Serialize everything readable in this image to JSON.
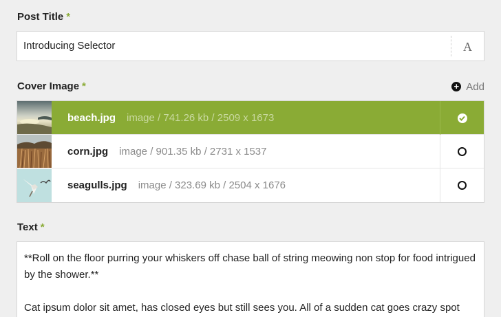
{
  "post_title": {
    "label": "Post Title",
    "required_mark": "*",
    "value": "Introducing Selector",
    "format_icon": "A"
  },
  "cover_image": {
    "label": "Cover Image",
    "required_mark": "*",
    "add_label": "Add",
    "add_icon": "plus-circle-icon",
    "images": [
      {
        "name": "beach.jpg",
        "meta": "image / 741.26 kb / 2509 x 1673",
        "selected": true
      },
      {
        "name": "corn.jpg",
        "meta": "image / 901.35 kb / 2731 x 1537",
        "selected": false
      },
      {
        "name": "seagulls.jpg",
        "meta": "image / 323.69 kb / 2504 x 1676",
        "selected": false
      }
    ],
    "accent_color": "#8aab35"
  },
  "text_field": {
    "label": "Text",
    "required_mark": "*",
    "paragraphs": [
      "**Roll on the floor purring your whiskers off chase ball of string meowing non stop for food intrigued by the shower.**",
      "Cat ipsum dolor sit amet, has closed eyes but still sees you. All of a sudden cat goes crazy spot"
    ]
  }
}
